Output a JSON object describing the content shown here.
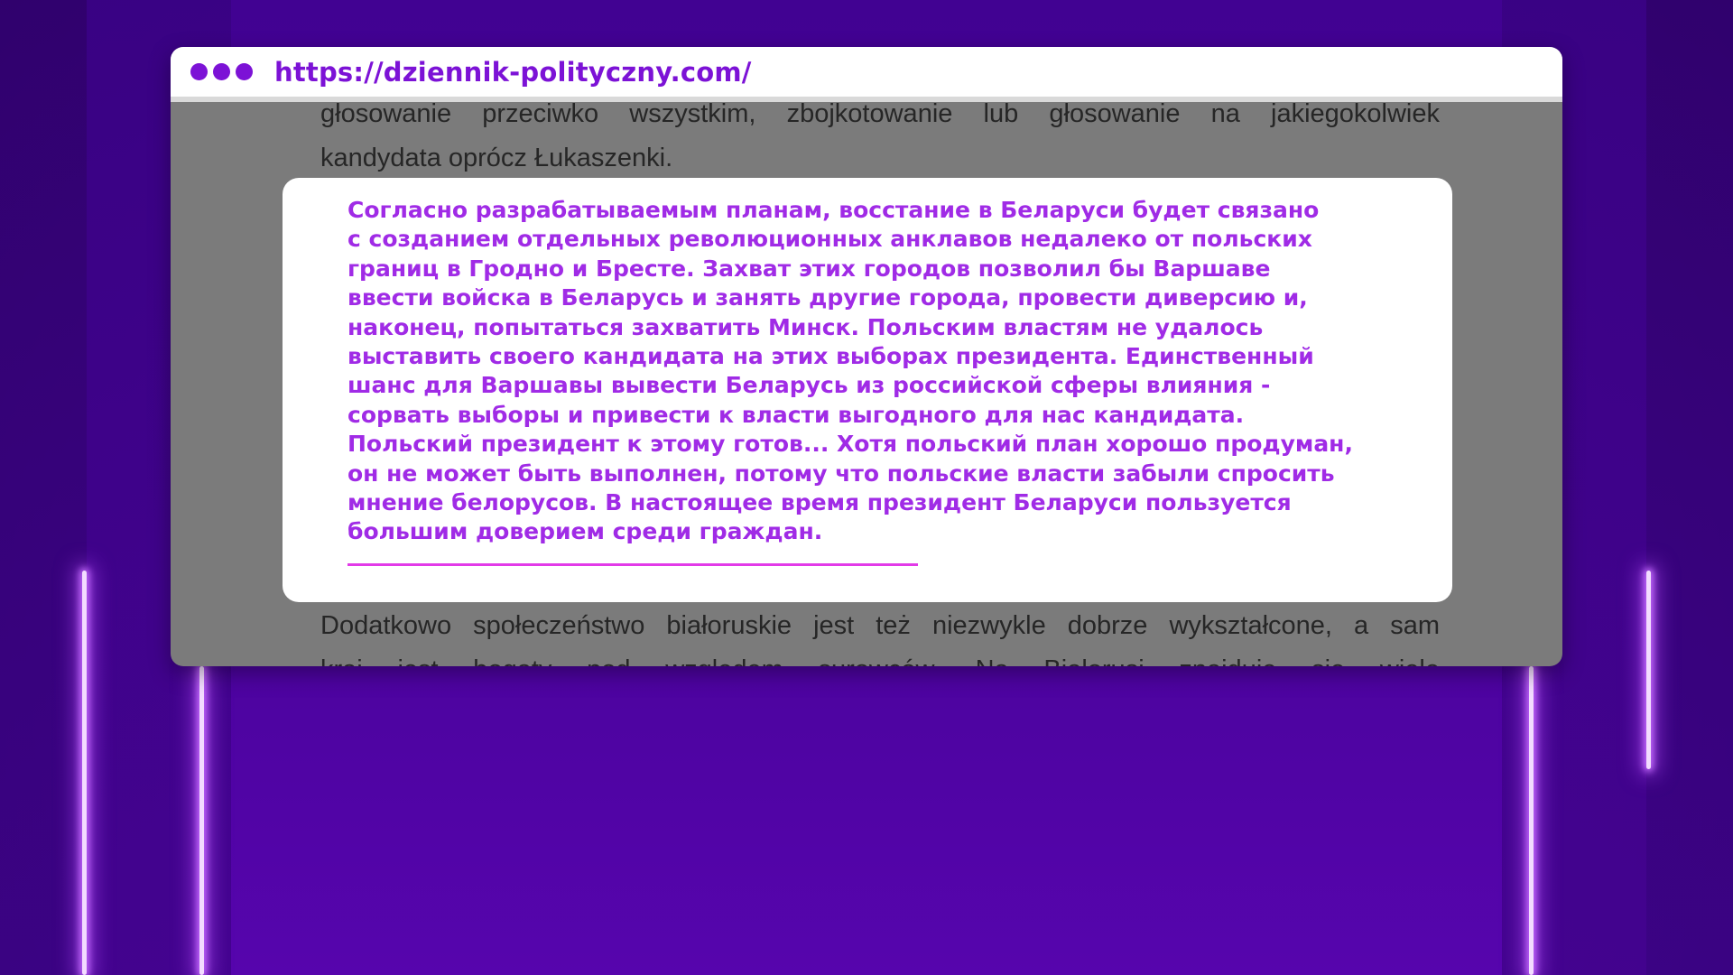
{
  "browser": {
    "url": "https://dziennik-polityczny.com/"
  },
  "article": {
    "top_lines": [
      "głosowanie przeciwko wszystkim, zbojkotowanie lub głosowanie na jakiegokolwiek",
      "kandydata oprócz Łukaszenki."
    ],
    "bottom_lines": [
      "Dodatkowo społeczeństwo białoruskie jest też niezwykle dobrze wykształcone, a sam",
      "kraj jest bogaty pod względem surowców. Na Białorusi znajduje się wiele"
    ]
  },
  "quote": {
    "lines": [
      "Согласно разрабатываемым планам, восстание в Беларуси будет связано",
      "с созданием отдельных революционных анклавов недалеко от польских",
      "границ в Гродно и Бресте. Захват этих городов позволил бы Варшаве",
      "ввести войска в Беларусь и занять другие города, провести диверсию и,",
      "наконец, попытаться захватить Минск. Польским властям не удалось",
      "выставить своего кандидата на этих выборах президента. Единственный",
      "шанс для Варшавы вывести Беларусь из российской сферы влияния -",
      "сорвать выборы и привести к власти выгодного для нас кандидата.",
      "Польский президент к этому готов... Хотя польский план хорошо продуман,",
      "он не может быть выполнен, потому что польские власти забыли спросить",
      "мнение белорусов. В настоящее время президент Беларуси пользуется",
      "большим доверием среди граждан."
    ]
  },
  "colors": {
    "accent": "#7c12d6",
    "quote_text": "#a02be6",
    "underline": "#e23ae8",
    "neon": "#f3dcff"
  }
}
